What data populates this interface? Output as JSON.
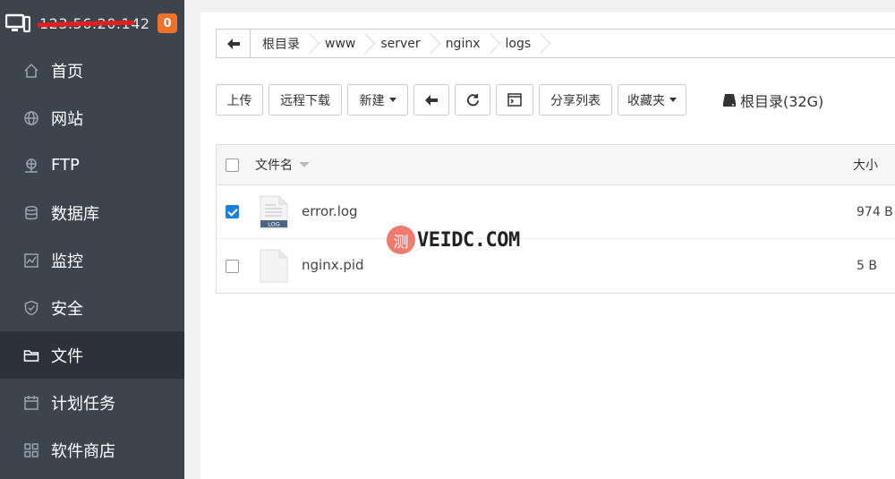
{
  "server": {
    "ip": "123.56.20.142",
    "alert_count": "0"
  },
  "nav": [
    {
      "label": "首页",
      "icon": "home-icon"
    },
    {
      "label": "网站",
      "icon": "globe-icon"
    },
    {
      "label": "FTP",
      "icon": "ftp-icon"
    },
    {
      "label": "数据库",
      "icon": "database-icon"
    },
    {
      "label": "监控",
      "icon": "monitor-chart-icon"
    },
    {
      "label": "安全",
      "icon": "shield-icon"
    },
    {
      "label": "文件",
      "icon": "folder-icon",
      "active": true
    },
    {
      "label": "计划任务",
      "icon": "calendar-icon"
    },
    {
      "label": "软件商店",
      "icon": "apps-icon"
    }
  ],
  "breadcrumb": [
    "根目录",
    "www",
    "server",
    "nginx",
    "logs"
  ],
  "toolbar": {
    "upload": "上传",
    "remote_download": "远程下载",
    "new": "新建",
    "share_list": "分享列表",
    "favorites": "收藏夹",
    "disk_label": "根目录(32G)"
  },
  "table": {
    "col_name": "文件名",
    "col_size": "大小",
    "rows": [
      {
        "name": "error.log",
        "size": "974 B",
        "checked": true,
        "icon_badge": "LOG"
      },
      {
        "name": "nginx.pid",
        "size": "5 B",
        "checked": false
      }
    ]
  },
  "watermark": {
    "badge": "测",
    "text": "VEIDC.COM"
  },
  "colors": {
    "sidebar": "#3c444d",
    "sidebar_active": "#2d3238",
    "badge": "#f0712a",
    "checkbox": "#1e7fe0"
  }
}
